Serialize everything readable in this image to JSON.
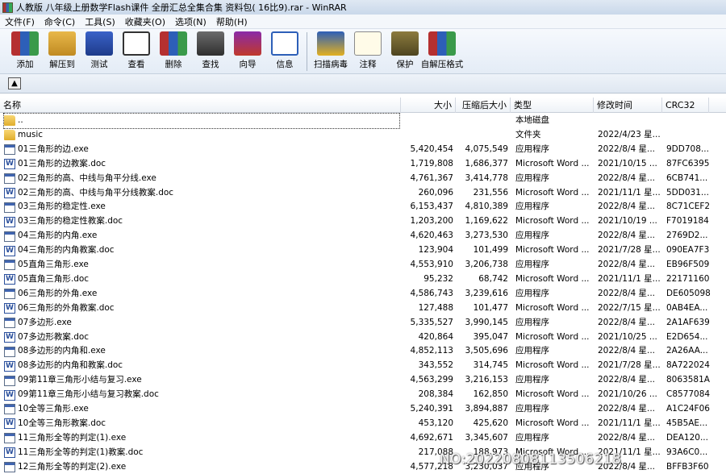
{
  "window": {
    "title": "人教版 八年级上册数学Flash课件 全册汇总全集合集 资料包( 16比9).rar - WinRAR"
  },
  "menu": [
    "文件(F)",
    "命令(C)",
    "工具(S)",
    "收藏夹(O)",
    "选项(N)",
    "帮助(H)"
  ],
  "toolbar": [
    {
      "id": "add",
      "label": "添加",
      "icon": "books-add-icon"
    },
    {
      "id": "extract",
      "label": "解压到",
      "icon": "folder-extract-icon"
    },
    {
      "id": "test",
      "label": "测试",
      "icon": "book-check-icon"
    },
    {
      "id": "view",
      "label": "查看",
      "icon": "glasses-icon"
    },
    {
      "id": "delete",
      "label": "删除",
      "icon": "delete-icon"
    },
    {
      "id": "find",
      "label": "查找",
      "icon": "binoculars-icon"
    },
    {
      "id": "wizard",
      "label": "向导",
      "icon": "wizard-icon"
    },
    {
      "id": "info",
      "label": "信息",
      "icon": "info-icon"
    },
    {
      "id": "virus",
      "label": "扫描病毒",
      "icon": "virus-scan-icon",
      "sep_before": true
    },
    {
      "id": "comment",
      "label": "注释",
      "icon": "comment-icon"
    },
    {
      "id": "protect",
      "label": "保护",
      "icon": "shield-icon"
    },
    {
      "id": "sfx",
      "label": "自解压格式",
      "icon": "sfx-icon"
    }
  ],
  "columns": {
    "name": "名称",
    "size": "大小",
    "packed": "压缩后大小",
    "type": "类型",
    "modified": "修改时间",
    "crc": "CRC32"
  },
  "files": [
    {
      "name": "..",
      "size": "",
      "packed": "",
      "type": "本地磁盘",
      "modified": "",
      "crc": "",
      "icon": "folder"
    },
    {
      "name": "music",
      "size": "",
      "packed": "",
      "type": "文件夹",
      "modified": "2022/4/23 星...",
      "crc": "",
      "icon": "folder"
    },
    {
      "name": "01三角形的边.exe",
      "size": "5,420,454",
      "packed": "4,075,549",
      "type": "应用程序",
      "modified": "2022/8/4 星...",
      "crc": "9DD708...",
      "icon": "exe"
    },
    {
      "name": "01三角形的边教案.doc",
      "size": "1,719,808",
      "packed": "1,686,377",
      "type": "Microsoft Word ...",
      "modified": "2021/10/15 ...",
      "crc": "87FC6395",
      "icon": "doc"
    },
    {
      "name": "02三角形的高、中线与角平分线.exe",
      "size": "4,761,367",
      "packed": "3,414,778",
      "type": "应用程序",
      "modified": "2022/8/4 星...",
      "crc": "6CB741...",
      "icon": "exe"
    },
    {
      "name": "02三角形的高、中线与角平分线教案.doc",
      "size": "260,096",
      "packed": "231,556",
      "type": "Microsoft Word ...",
      "modified": "2021/11/1 星...",
      "crc": "5DD031...",
      "icon": "doc"
    },
    {
      "name": "03三角形的稳定性.exe",
      "size": "6,153,437",
      "packed": "4,810,389",
      "type": "应用程序",
      "modified": "2022/8/4 星...",
      "crc": "8C71CEF2",
      "icon": "exe"
    },
    {
      "name": "03三角形的稳定性教案.doc",
      "size": "1,203,200",
      "packed": "1,169,622",
      "type": "Microsoft Word ...",
      "modified": "2021/10/19 ...",
      "crc": "F7019184",
      "icon": "doc"
    },
    {
      "name": "04三角形的内角.exe",
      "size": "4,620,463",
      "packed": "3,273,530",
      "type": "应用程序",
      "modified": "2022/8/4 星...",
      "crc": "2769D2...",
      "icon": "exe"
    },
    {
      "name": "04三角形的内角教案.doc",
      "size": "123,904",
      "packed": "101,499",
      "type": "Microsoft Word ...",
      "modified": "2021/7/28 星...",
      "crc": "090EA7F3",
      "icon": "doc"
    },
    {
      "name": "05直角三角形.exe",
      "size": "4,553,910",
      "packed": "3,206,738",
      "type": "应用程序",
      "modified": "2022/8/4 星...",
      "crc": "EB96F509",
      "icon": "exe"
    },
    {
      "name": "05直角三角形.doc",
      "size": "95,232",
      "packed": "68,742",
      "type": "Microsoft Word ...",
      "modified": "2021/11/1 星...",
      "crc": "22171160",
      "icon": "doc"
    },
    {
      "name": "06三角形的外角.exe",
      "size": "4,586,743",
      "packed": "3,239,616",
      "type": "应用程序",
      "modified": "2022/8/4 星...",
      "crc": "DE605098",
      "icon": "exe"
    },
    {
      "name": "06三角形的外角教案.doc",
      "size": "127,488",
      "packed": "101,477",
      "type": "Microsoft Word ...",
      "modified": "2022/7/15 星...",
      "crc": "0AB4EA...",
      "icon": "doc"
    },
    {
      "name": "07多边形.exe",
      "size": "5,335,527",
      "packed": "3,990,145",
      "type": "应用程序",
      "modified": "2022/8/4 星...",
      "crc": "2A1AF639",
      "icon": "exe"
    },
    {
      "name": "07多边形教案.doc",
      "size": "420,864",
      "packed": "395,047",
      "type": "Microsoft Word ...",
      "modified": "2021/10/25 ...",
      "crc": "E2D654...",
      "icon": "doc"
    },
    {
      "name": "08多边形的内角和.exe",
      "size": "4,852,113",
      "packed": "3,505,696",
      "type": "应用程序",
      "modified": "2022/8/4 星...",
      "crc": "2A26AA...",
      "icon": "exe"
    },
    {
      "name": "08多边形的内角和教案.doc",
      "size": "343,552",
      "packed": "314,745",
      "type": "Microsoft Word ...",
      "modified": "2021/7/28 星...",
      "crc": "8A722024",
      "icon": "doc"
    },
    {
      "name": "09第11章三角形小结与复习.exe",
      "size": "4,563,299",
      "packed": "3,216,153",
      "type": "应用程序",
      "modified": "2022/8/4 星...",
      "crc": "8063581A",
      "icon": "exe"
    },
    {
      "name": "09第11章三角形小结与复习教案.doc",
      "size": "208,384",
      "packed": "162,850",
      "type": "Microsoft Word ...",
      "modified": "2021/10/26 ...",
      "crc": "C8577084",
      "icon": "doc"
    },
    {
      "name": "10全等三角形.exe",
      "size": "5,240,391",
      "packed": "3,894,887",
      "type": "应用程序",
      "modified": "2022/8/4 星...",
      "crc": "A1C24F06",
      "icon": "exe"
    },
    {
      "name": "10全等三角形教案.doc",
      "size": "453,120",
      "packed": "425,620",
      "type": "Microsoft Word ...",
      "modified": "2021/11/1 星...",
      "crc": "45B5AE...",
      "icon": "doc"
    },
    {
      "name": "11三角形全等的判定(1).exe",
      "size": "4,692,671",
      "packed": "3,345,607",
      "type": "应用程序",
      "modified": "2022/8/4 星...",
      "crc": "DEA120...",
      "icon": "exe"
    },
    {
      "name": "11三角形全等的判定(1)教案.doc",
      "size": "217,088",
      "packed": "188,973",
      "type": "Microsoft Word ...",
      "modified": "2021/11/1 星...",
      "crc": "93A6C0...",
      "icon": "doc"
    },
    {
      "name": "12三角形全等的判定(2).exe",
      "size": "4,577,218",
      "packed": "3,230,037",
      "type": "应用程序",
      "modified": "2022/8/4 星...",
      "crc": "BFFB3F60",
      "icon": "exe"
    }
  ],
  "watermark": "NO:20220808113506218"
}
